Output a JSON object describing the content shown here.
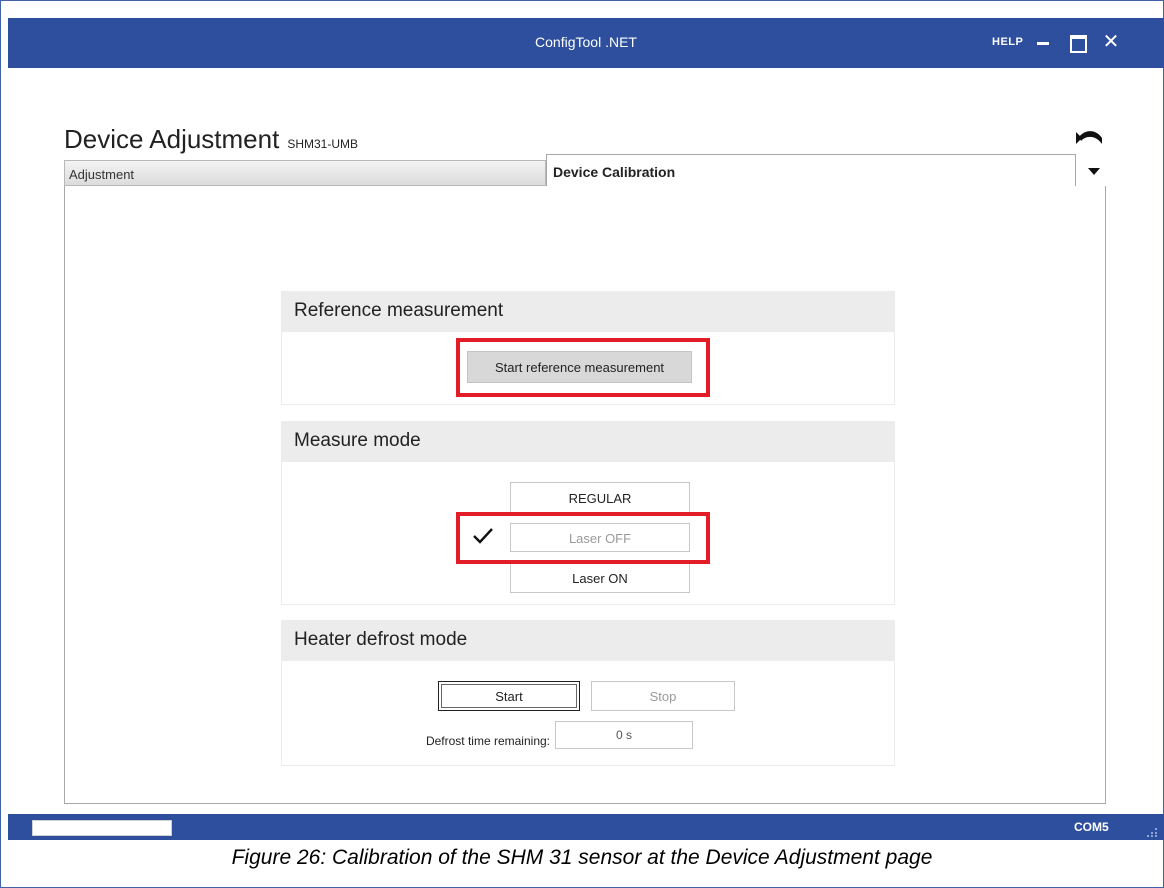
{
  "window": {
    "title": "ConfigTool .NET",
    "help_label": "HELP",
    "minimize_icon": "minimize-icon",
    "maximize_icon": "maximize-icon",
    "close_glyph": "✕"
  },
  "page": {
    "title": "Device Adjustment",
    "device": "SHM31-UMB",
    "undo_icon": "undo-icon"
  },
  "tabs": [
    {
      "label": "Adjustment",
      "active": false
    },
    {
      "label": "Device Calibration",
      "active": true
    }
  ],
  "reference": {
    "heading": "Reference measurement",
    "button_label": "Start reference measurement"
  },
  "measure_mode": {
    "heading": "Measure mode",
    "options": [
      {
        "label": "REGULAR",
        "selected": false
      },
      {
        "label": "Laser OFF",
        "selected": true
      },
      {
        "label": "Laser ON",
        "selected": false
      }
    ]
  },
  "heater": {
    "heading": "Heater defrost mode",
    "start_label": "Start",
    "stop_label": "Stop",
    "remaining_label": "Defrost time remaining:",
    "remaining_value": "0 s"
  },
  "statusbar": {
    "port": "COM5"
  },
  "caption": "Figure 26: Calibration of the SHM 31 sensor at the Device Adjustment page",
  "colors": {
    "titlebar": "#2d4f9e",
    "highlight": "#e21d27",
    "group_header": "#ececec"
  }
}
